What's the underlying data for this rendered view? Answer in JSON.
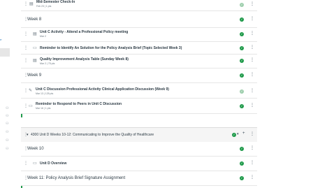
{
  "nav": {
    "top_link": "rr",
    "icons": [
      "people-icon",
      "people-icon",
      "people-icon",
      "people-icon",
      "people-icon",
      "people-icon"
    ]
  },
  "items": [
    {
      "title": "Mid-Semester Check-In",
      "meta": "Feb 23  |  1 pts",
      "type": "assignment",
      "indent": 1,
      "published": true
    },
    {
      "title": "Week 8",
      "type": "header",
      "indent": 0,
      "published": true
    },
    {
      "title": "Unit C Activity - Attend a Professional Policy meeting",
      "meta": "Mar 2",
      "type": "assignment",
      "indent": 2,
      "published": true
    },
    {
      "title": "Reminder to Identify An Solution for the Policy Analysis Brief (Topic Selected Week 3)",
      "type": "page",
      "indent": 2,
      "published": true
    },
    {
      "title": "Quality Improvement Analysis Table (Sunday Week 8)",
      "meta": "Mar 2  |  75 pts",
      "type": "assignment",
      "indent": 2,
      "published": true
    },
    {
      "title": "Week 9",
      "type": "header",
      "indent": 0,
      "published": true
    },
    {
      "title": "Unit C Discussion Professional Activity Clinical Application Discussion (Week 9)",
      "meta": "Mar 13  |  125 pts",
      "type": "discussion",
      "indent": 1,
      "published": true
    },
    {
      "title": "Reminder to Respond to Peers in Unit C Discussion",
      "meta": "Mar 16  |  1 pts",
      "type": "page",
      "indent": 1,
      "published": true
    }
  ],
  "module": {
    "title": "4300 Unit D Weeks 10-12: Communicating to Improve the Quality of Healthcare",
    "caret": "▾",
    "add": "+"
  },
  "items2": [
    {
      "title": "Week 10",
      "type": "header",
      "indent": 0,
      "published": true
    },
    {
      "title": "Unit D Overview",
      "type": "page",
      "indent": 2,
      "published": true
    },
    {
      "title": "Week 11: Policy Analysis Brief Signature Assignment",
      "type": "header",
      "indent": 0,
      "published": true
    }
  ],
  "colors": {
    "published": "#1f9a4a",
    "accent": "#2b7abc"
  }
}
